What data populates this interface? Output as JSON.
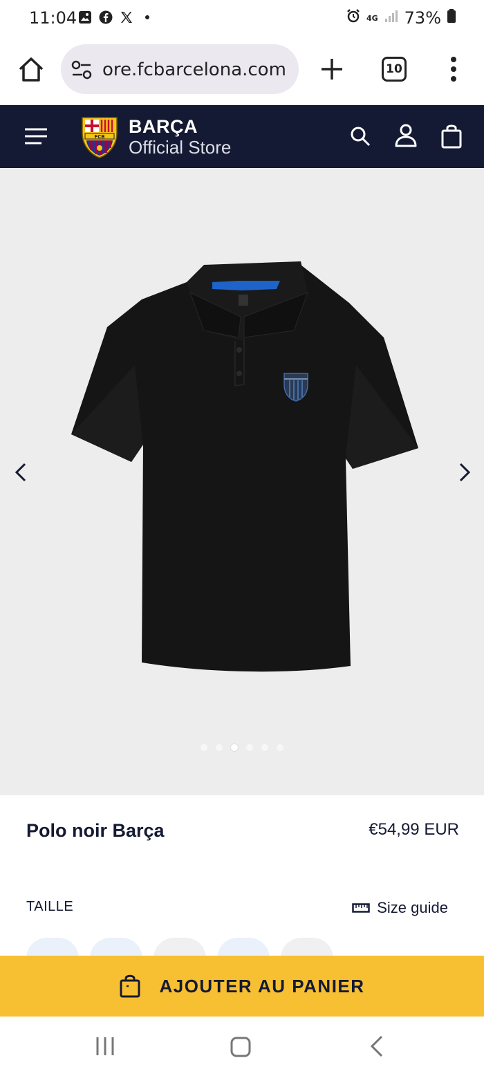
{
  "status_bar": {
    "time": "11:04",
    "battery": "73%",
    "network": "4G"
  },
  "browser": {
    "url": "ore.fcbarcelona.com",
    "tab_count": "10"
  },
  "store_header": {
    "brand_name": "BARÇA",
    "brand_sub": "Official Store"
  },
  "gallery": {
    "dot_count": 6,
    "active_dot": 3
  },
  "product": {
    "title": "Polo noir Barça",
    "price": "€54,99 EUR",
    "size_label": "TAILLE",
    "size_guide": "Size guide"
  },
  "cart": {
    "label": "AJOUTER AU PANIER"
  },
  "colors": {
    "header_bg": "#141a33",
    "cart_bg": "#f7bf32",
    "gallery_bg": "#ededed"
  }
}
